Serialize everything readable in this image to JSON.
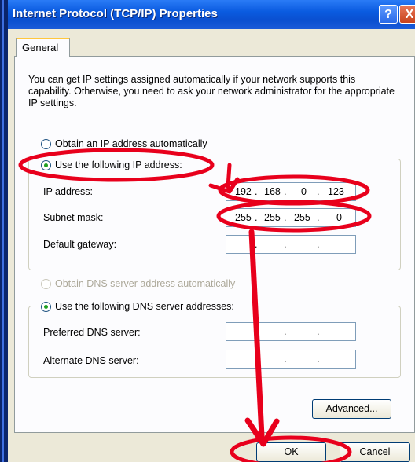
{
  "window": {
    "title": "Internet Protocol (TCP/IP) Properties",
    "help_glyph": "?",
    "close_glyph": "X"
  },
  "tabs": [
    {
      "label": "General"
    }
  ],
  "description": "You can get IP settings assigned automatically if your network supports this capability. Otherwise, you need to ask your network administrator for the appropriate IP settings.",
  "ip_options": {
    "auto_label": "Obtain an IP address automatically",
    "manual_label": "Use the following IP address:",
    "selected": "manual"
  },
  "ip_fields": {
    "ip_address": {
      "label": "IP address:",
      "octets": [
        "192",
        "168",
        "0",
        "123"
      ]
    },
    "subnet_mask": {
      "label": "Subnet mask:",
      "octets": [
        "255",
        "255",
        "255",
        "0"
      ]
    },
    "default_gateway": {
      "label": "Default gateway:",
      "octets": [
        "",
        "",
        "",
        ""
      ]
    }
  },
  "dns_options": {
    "auto_label": "Obtain DNS server address automatically",
    "manual_label": "Use the following DNS server addresses:",
    "selected": "manual"
  },
  "dns_fields": {
    "preferred": {
      "label": "Preferred DNS server:",
      "octets": [
        "",
        "",
        "",
        ""
      ]
    },
    "alternate": {
      "label": "Alternate DNS server:",
      "octets": [
        "",
        "",
        "",
        ""
      ]
    }
  },
  "buttons": {
    "advanced": "Advanced...",
    "ok": "OK",
    "cancel": "Cancel"
  },
  "colors": {
    "titlebar": "#0a5be0",
    "annotation": "#e8001c",
    "radio_dot": "#21a121"
  }
}
